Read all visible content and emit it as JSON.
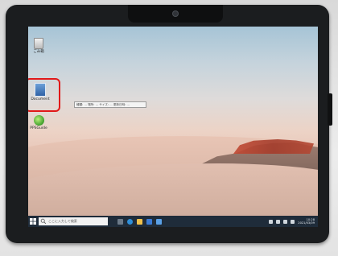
{
  "desktop": {
    "icons": [
      {
        "label": "ごみ箱",
        "glyph": "recycle-bin-icon"
      },
      {
        "label": "Document",
        "glyph": "document-shortcut-icon"
      },
      {
        "label": "PPSGuide",
        "glyph": "green-app-icon"
      }
    ],
    "tooltip": "種類: ... 場所: ... サイズ: ... 更新日時: ..."
  },
  "taskbar": {
    "search_placeholder": "ここに入力して検索",
    "apps": [
      "task-view-icon",
      "edge-icon",
      "file-explorer-icon",
      "store-icon",
      "mail-icon"
    ],
    "tray": [
      "chevron-up-icon",
      "network-icon",
      "volume-icon",
      "ime-icon"
    ],
    "clock_time": "10:28",
    "clock_date": "2021/03/09"
  },
  "colors": {
    "taskbar": "#1f2c3a",
    "highlight": "#e11919",
    "bezel": "#1b1d1f"
  }
}
